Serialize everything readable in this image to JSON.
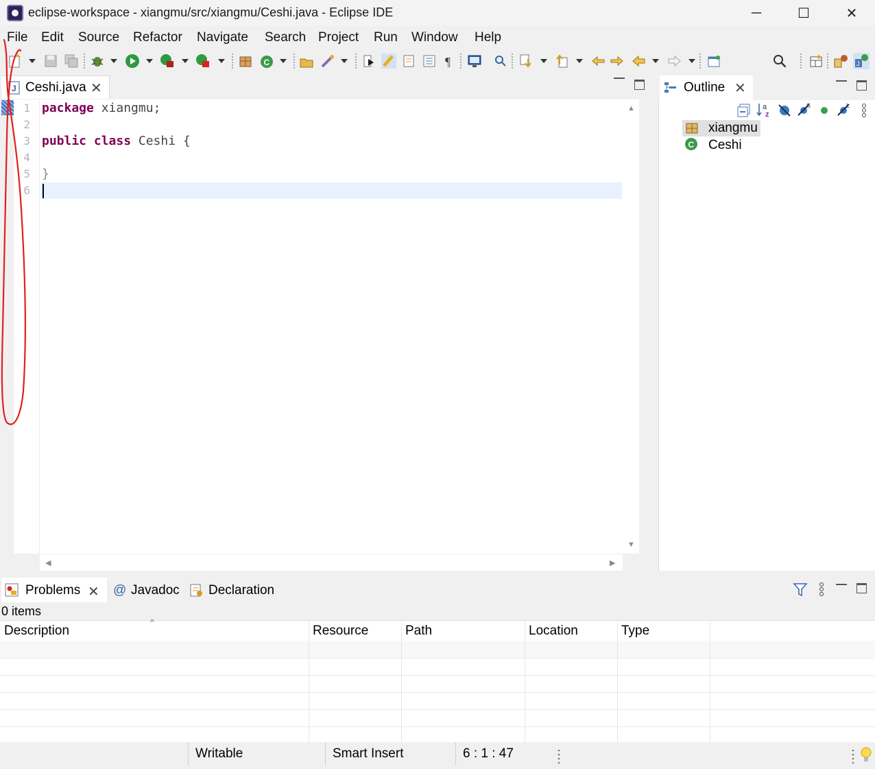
{
  "window": {
    "title": "eclipse-workspace - xiangmu/src/xiangmu/Ceshi.java - Eclipse IDE",
    "controls": {
      "minimize": "─",
      "maximize": "☐",
      "close": "✕"
    }
  },
  "menu": [
    "File",
    "Edit",
    "Source",
    "Refactor",
    "Navigate",
    "Search",
    "Project",
    "Run",
    "Window",
    "Help"
  ],
  "editor": {
    "tab_label": "Ceshi.java",
    "line_numbers": [
      "1",
      "2",
      "3",
      "4",
      "5",
      "6"
    ],
    "lines": [
      {
        "kw": "package",
        "rest": " xiangmu;"
      },
      {
        "kw": "",
        "rest": ""
      },
      {
        "kw": "public class",
        "rest": " Ceshi {"
      },
      {
        "kw": "",
        "rest": ""
      },
      {
        "kw": "",
        "rest": "}"
      },
      {
        "kw": "",
        "rest": ""
      }
    ],
    "current_line": 6
  },
  "outline": {
    "tab_label": "Outline",
    "items": [
      {
        "label": "xiangmu",
        "icon": "package-icon"
      },
      {
        "label": "Ceshi",
        "icon": "class-icon"
      }
    ]
  },
  "bottom": {
    "tabs": [
      "Problems",
      "Javadoc",
      "Declaration"
    ],
    "items_count": "0 items",
    "columns": [
      "Description",
      "Resource",
      "Path",
      "Location",
      "Type"
    ]
  },
  "status": {
    "writable": "Writable",
    "insert_mode": "Smart Insert",
    "position": "6 : 1 : 47"
  },
  "colors": {
    "keyword": "#7f0055",
    "annotation": "#e0201b",
    "current_line": "#e8f2fe"
  }
}
